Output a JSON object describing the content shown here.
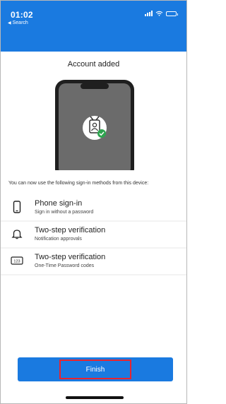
{
  "status_bar": {
    "time": "01:02",
    "back_label": "Search",
    "accent_color": "#1a7ae0"
  },
  "sheet": {
    "title": "Account added",
    "message": "You can now use the following sign-in methods from this device:",
    "illustration_icon": "badge-check-icon"
  },
  "methods": [
    {
      "icon": "phone-icon",
      "title": "Phone sign-in",
      "subtitle": "Sign in without a password"
    },
    {
      "icon": "bell-icon",
      "title": "Two-step verification",
      "subtitle": "Notification approvals"
    },
    {
      "icon": "numeric-code-icon",
      "title": "Two-step verification",
      "subtitle": "One-Time Password codes"
    }
  ],
  "finish": {
    "label": "Finish",
    "highlight_color": "#e8242f"
  }
}
